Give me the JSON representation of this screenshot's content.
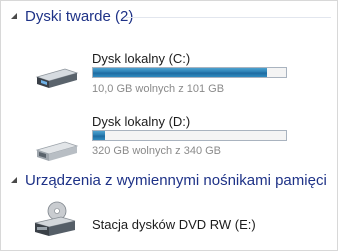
{
  "sections": {
    "hard_disks": {
      "title": "Dyski twarde (2)",
      "drives": [
        {
          "name": "Dysk lokalny (C:)",
          "free_text": "10,0 GB wolnych z 101 GB",
          "used_fraction": 0.9,
          "icon": "hard-drive-icon"
        },
        {
          "name": "Dysk lokalny (D:)",
          "free_text": "320 GB wolnych z 340 GB",
          "used_fraction": 0.06,
          "icon": "hard-drive-icon"
        }
      ]
    },
    "removable": {
      "title": "Urządzenia z wymiennymi nośnikami pamięci",
      "drives": [
        {
          "name": "Stacja dysków DVD RW (E:)",
          "icon": "dvd-drive-icon"
        }
      ]
    }
  },
  "colors": {
    "header_text": "#1e3287",
    "bar_fill": "#2a7eb3",
    "bar_border": "#a9b3bf"
  }
}
